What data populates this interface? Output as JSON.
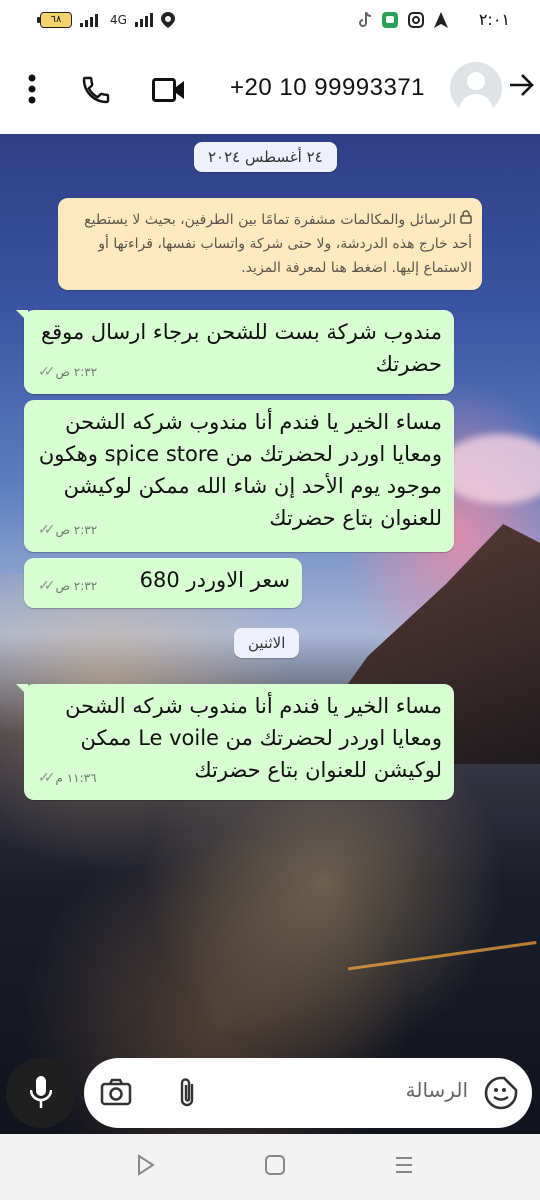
{
  "status_bar": {
    "time": "٢:٠١",
    "battery": "٦٨",
    "network": "4G"
  },
  "header": {
    "title": "+20 10 99993371",
    "icons": [
      "more-vert-icon",
      "phone-icon",
      "video-call-icon",
      "avatar",
      "back-arrow-icon"
    ]
  },
  "chat": {
    "date_label": "٢٤ أغسطس ٢٠٢٤",
    "encryption_notice": "الرسائل والمكالمات مشفرة تمامًا بين الطرفين، بحيث لا يستطيع أحد خارج هذه الدردشة، ولا حتى شركة واتساب نفسها، قراءتها أو الاستماع إليها. اضغط هنا لمعرفة المزيد.",
    "day_label": "الاثنين",
    "messages": [
      {
        "text": "مندوب شركة بست للشحن برجاء ارسال موقع حضرتك",
        "time": "٢:٣٢ ص"
      },
      {
        "text": "مساء الخير يا فندم أنا مندوب شركه الشحن ومعايا اوردر لحضرتك من spice store وهكون موجود يوم الأحد إن شاء الله ممكن لوكيشن للعنوان بتاع حضرتك",
        "time": "٢:٣٢ ص"
      },
      {
        "text": "سعر الاوردر 680",
        "time": "٢:٣٢ ص"
      },
      {
        "text": "مساء الخير يا فندم أنا مندوب شركه الشحن ومعايا اوردر لحضرتك من Le voile ممكن لوكيشن للعنوان بتاع حضرتك",
        "time": "١١:٣٦ م"
      }
    ]
  },
  "composer": {
    "placeholder": "الرسالة"
  },
  "colors": {
    "bubble_out": "#d9fdd3",
    "notice_bg": "#fde9c0",
    "date_pill": "#eef0fb"
  }
}
